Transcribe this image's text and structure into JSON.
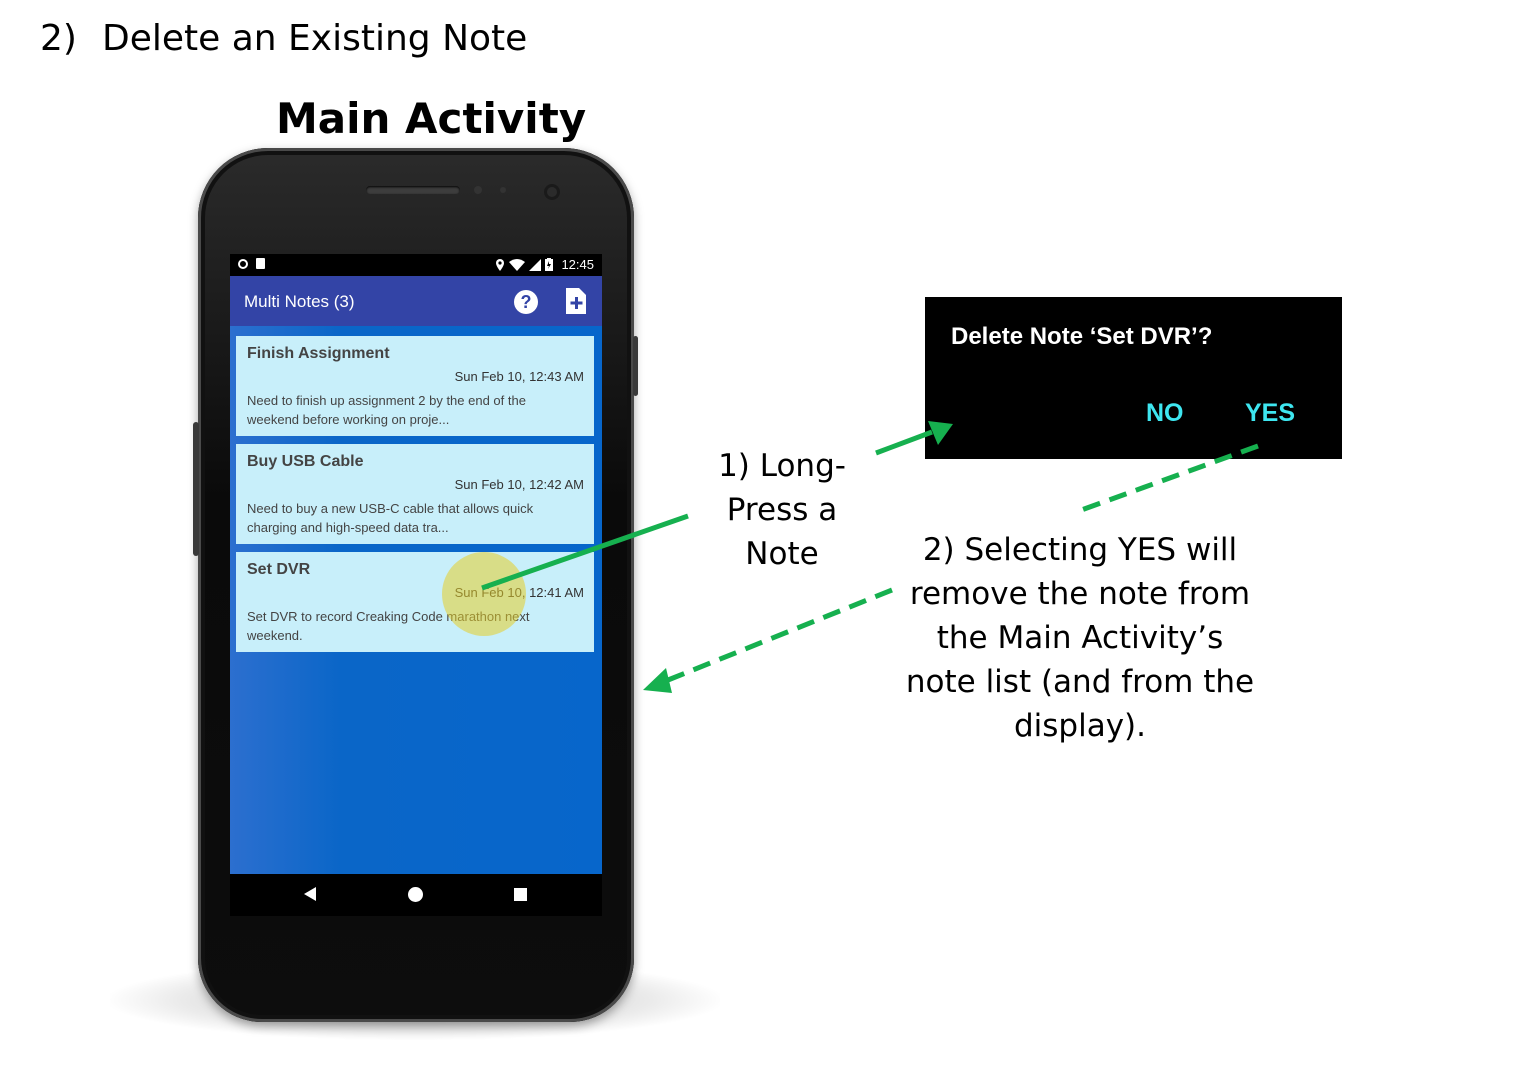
{
  "section_heading": {
    "number": "2)",
    "text": "Delete an Existing Note"
  },
  "main_title": "Main Activity",
  "status_bar": {
    "time": "12:45"
  },
  "app_bar": {
    "title": "Multi Notes (3)",
    "help_icon": "help-circle-icon",
    "add_icon": "add-note-icon"
  },
  "notes": [
    {
      "title": "Finish Assignment",
      "date": "Sun Feb 10, 12:43 AM",
      "text": "Need to finish up assignment 2 by the end of the weekend before working on proje..."
    },
    {
      "title": "Buy USB Cable",
      "date": "Sun Feb 10, 12:42 AM",
      "text": "Need to buy a new USB-C cable that allows quick charging and high-speed data tra..."
    },
    {
      "title": "Set DVR",
      "date": "Sun Feb 10, 12:41 AM",
      "text": "Set DVR to record Creaking Code marathon next weekend."
    }
  ],
  "dialog": {
    "title": "Delete Note ‘Set DVR’?",
    "no_label": "NO",
    "yes_label": "YES"
  },
  "callouts": {
    "step1": [
      "1) Long-",
      "Press a",
      "Note"
    ],
    "step2": [
      "2) Selecting YES will",
      "remove the note from",
      "the Main Activity’s",
      "note list (and from the",
      "display)."
    ]
  },
  "colors": {
    "app_bar": "#3344a6",
    "content_bg": "#0766cb",
    "note_card": "#c8effa",
    "dialog_button": "#3ee6f0",
    "arrow": "#16b04f",
    "touch_indicator": "#e6cd28"
  }
}
